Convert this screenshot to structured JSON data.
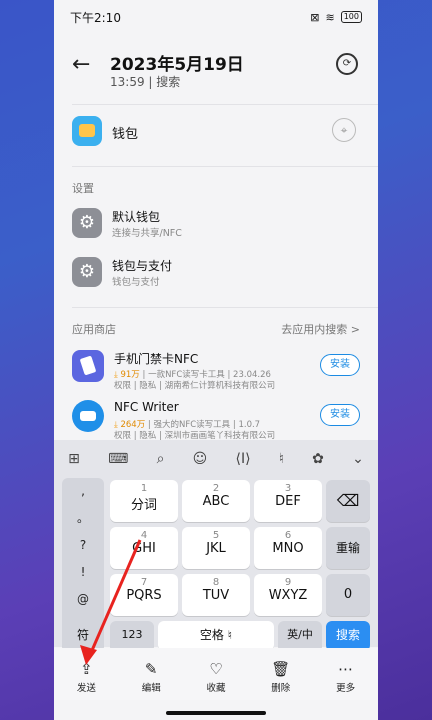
{
  "status": {
    "time": "下午2:10",
    "battery": "100"
  },
  "header": {
    "title": "2023年5月19日",
    "subtitle": "13:59 | 搜索"
  },
  "top_app": {
    "label": "钱包"
  },
  "settings": {
    "section": "设置",
    "items": [
      {
        "title": "默认钱包",
        "subtitle": "连接与共享/NFC"
      },
      {
        "title": "钱包与支付",
        "subtitle": "钱包与支付"
      }
    ]
  },
  "store": {
    "section": "应用商店",
    "go_link": "去应用内搜索 >",
    "apps": [
      {
        "name": "手机门禁卡NFC",
        "downloads": "91万",
        "desc": "一款NFC读写卡工具",
        "date": "23.04.26",
        "perm": "权限",
        "privacy": "隐私",
        "dev": "湖南希仁计算机科技有限公司",
        "install": "安装"
      },
      {
        "name": "NFC Writer",
        "downloads": "264万",
        "desc": "强大的NFC读写工具",
        "date": "1.0.7",
        "perm": "权限",
        "privacy": "隐私",
        "dev": "深圳市画画笔丫科技有限公司",
        "install": "安装"
      }
    ]
  },
  "keyboard": {
    "symbols": [
      ",",
      "。",
      "?",
      "!",
      "@"
    ],
    "rows": [
      [
        {
          "num": "1",
          "lab": "分词"
        },
        {
          "num": "2",
          "lab": "ABC"
        },
        {
          "num": "3",
          "lab": "DEF"
        }
      ],
      [
        {
          "num": "4",
          "lab": "GHI"
        },
        {
          "num": "5",
          "lab": "JKL"
        },
        {
          "num": "6",
          "lab": "MNO"
        }
      ],
      [
        {
          "num": "7",
          "lab": "PQRS"
        },
        {
          "num": "8",
          "lab": "TUV"
        },
        {
          "num": "9",
          "lab": "WXYZ"
        }
      ]
    ],
    "side": {
      "delete": "⌫",
      "reenter": "重输",
      "zero": "0"
    },
    "bottom": {
      "sym": "符",
      "num": "123",
      "space": "空格",
      "lang": "英/中",
      "search": "搜索"
    }
  },
  "actions": [
    {
      "label": "发送",
      "icon": "share-icon"
    },
    {
      "label": "编辑",
      "icon": "edit-icon"
    },
    {
      "label": "收藏",
      "icon": "heart-icon"
    },
    {
      "label": "删除",
      "icon": "trash-icon"
    },
    {
      "label": "更多",
      "icon": "more-icon"
    }
  ]
}
